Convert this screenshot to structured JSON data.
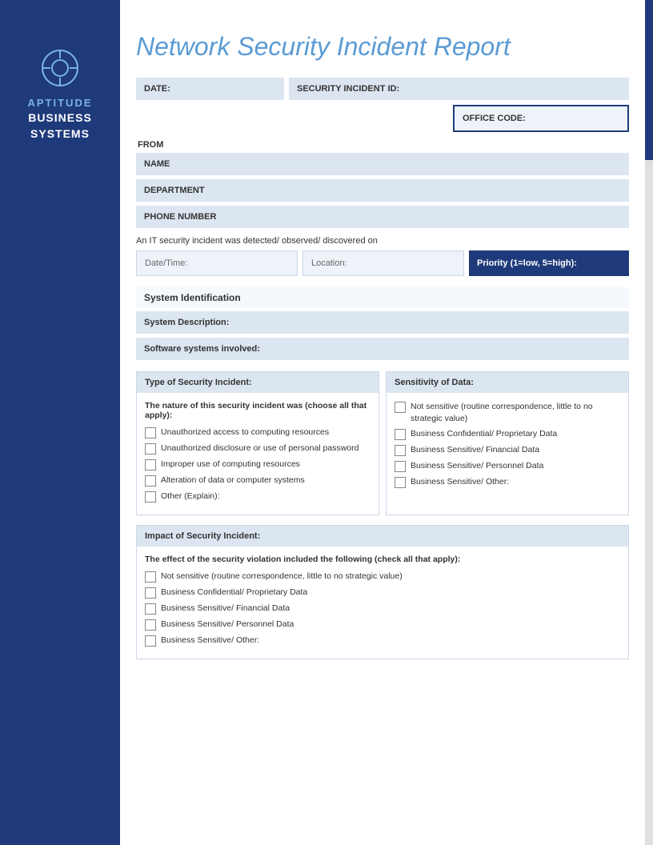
{
  "sidebar": {
    "brand_top": "APTITUDE",
    "brand_line1": "BUSINESS",
    "brand_line2": "SYSTEMS"
  },
  "header": {
    "title": "Network Security Incident Report"
  },
  "form": {
    "date_label": "DATE:",
    "security_id_label": "SECURITY INCIDENT ID:",
    "office_code_label": "OFFICE CODE:",
    "from_label": "FROM",
    "name_label": "NAME",
    "department_label": "DEPARTMENT",
    "phone_label": "PHONE NUMBER",
    "detected_text": "An IT security incident was detected/ observed/ discovered on",
    "datetime_label": "Date/Time:",
    "location_label": "Location:",
    "priority_label": "Priority (1=low, 5=high):",
    "system_id_label": "System Identification",
    "system_desc_label": "System Description:",
    "software_label": "Software systems involved:"
  },
  "type_section": {
    "header": "Type of Security Incident:",
    "sub_header": "The nature of this security incident was (choose all that apply):",
    "checkboxes": [
      "Unauthorized access to computing resources",
      "Unauthorized disclosure or use of personal password",
      "Improper use of computing resources",
      "Alteration of data or computer systems",
      "Other (Explain):"
    ]
  },
  "sensitivity_section": {
    "header": "Sensitivity of Data:",
    "checkboxes": [
      "Not sensitive (routine correspondence, little to no strategic value)",
      "Business Confidential/ Proprietary Data",
      "Business Sensitive/ Financial Data",
      "Business Sensitive/ Personnel Data",
      "Business Sensitive/ Other:"
    ]
  },
  "impact_section": {
    "header": "Impact of Security Incident:",
    "sub_header": "The effect of the security violation included the following (check all that apply):",
    "checkboxes": [
      "Not sensitive (routine correspondence, little to no strategic value)",
      "Business Confidential/ Proprietary Data",
      "Business Sensitive/ Financial Data",
      "Business Sensitive/ Personnel Data",
      "Business Sensitive/ Other:"
    ]
  }
}
